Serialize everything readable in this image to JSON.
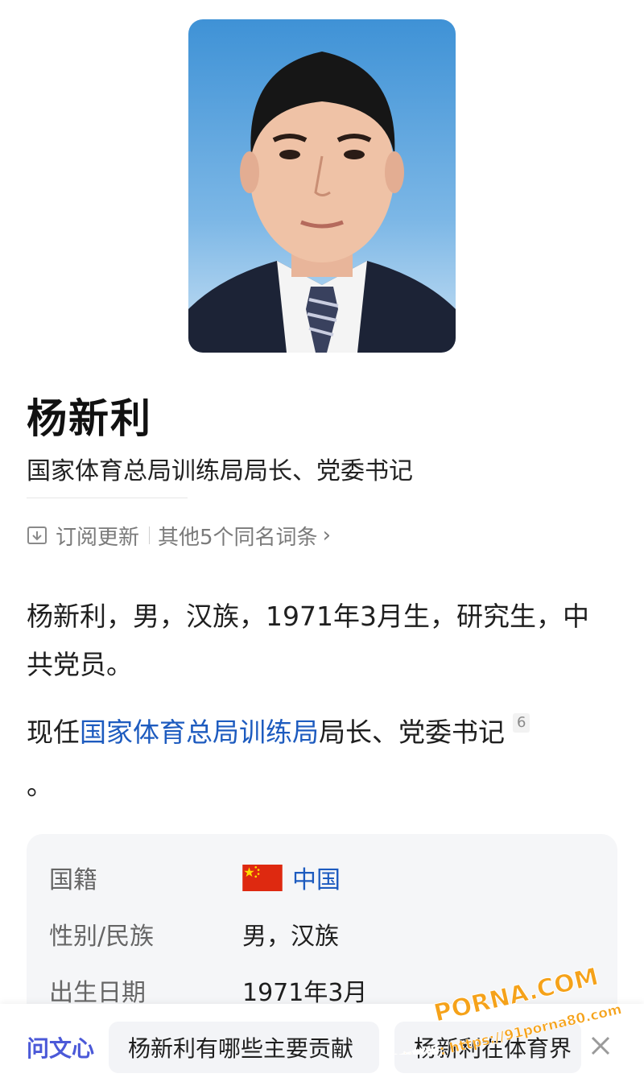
{
  "person": {
    "name": "杨新利",
    "title": "国家体育总局训练局局长、党委书记"
  },
  "actions": {
    "subscribe_label": "订阅更新",
    "subscribe_icon": "subscribe-icon",
    "same_name_label": "其他5个同名词条",
    "chevron": "›"
  },
  "summary": {
    "line1": "杨新利，男，汉族，1971年3月生，研究生，中共党员。",
    "current_prefix": "现任",
    "current_link": "国家体育总局训练局",
    "current_suffix": "局长、党委书记",
    "citation": "6",
    "period": "。"
  },
  "info": [
    {
      "label": "国籍",
      "value": "中国",
      "flag": "china-flag-icon",
      "link": true
    },
    {
      "label": "性别/民族",
      "value": "男，汉族"
    },
    {
      "label": "出生日期",
      "value": "1971年3月"
    }
  ],
  "bottom_bar": {
    "brand": "问文心",
    "suggestions": [
      "杨新利有哪些主要贡献",
      "杨新利在体育界"
    ],
    "close_icon": "close-icon"
  },
  "watermark": {
    "line1": "PORNA.COM",
    "line2": "看完整版: https://91porna80.com"
  },
  "colors": {
    "link": "#1d5bbf",
    "brand": "#4b59d8",
    "card_bg": "#f5f6f8",
    "watermark": "#f5a21a"
  }
}
